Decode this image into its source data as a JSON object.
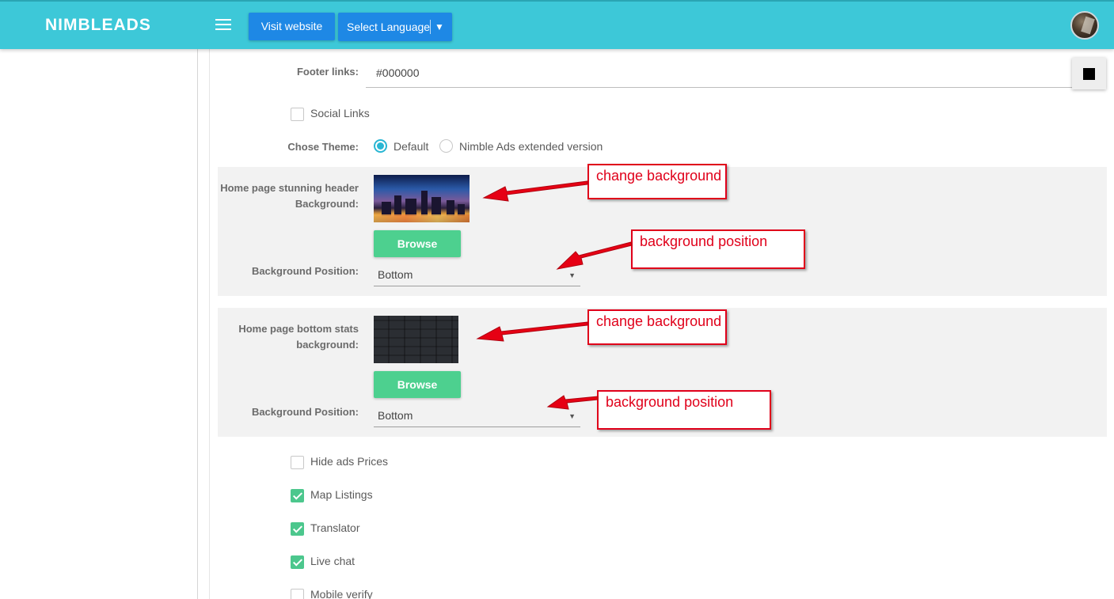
{
  "header": {
    "brand": "NIMBLEADS",
    "visit_label": "Visit website",
    "lang_label": "Select Language",
    "lang_caret": "▼"
  },
  "form": {
    "footer_links_label": "Footer links:",
    "footer_links_value": "#000000",
    "social_links_label": "Social Links",
    "theme_label": "Chose Theme:",
    "theme_option_default": "Default",
    "theme_option_extended": "Nimble Ads extended version",
    "home_header_bg_label": "Home page stunning header Background:",
    "home_bottom_bg_label": "Home page bottom stats background:",
    "browse_label": "Browse",
    "bg_position_label": "Background Position:",
    "bg_position_value_1": "Bottom",
    "bg_position_value_2": "Bottom",
    "hide_ads_prices_label": "Hide ads Prices",
    "map_listings_label": "Map Listings",
    "translator_label": "Translator",
    "live_chat_label": "Live chat",
    "mobile_verify_label": "Mobile verify"
  },
  "annotations": {
    "change_bg_1": "change background",
    "bg_pos_1": "background position",
    "change_bg_2": "change background",
    "bg_pos_2": "background position"
  },
  "colors": {
    "topbar": "#3dc8d8",
    "primary_button": "#1e88e5",
    "browse_button": "#4dd08f",
    "checkbox_on": "#4cc78d",
    "annotation_red": "#e0001a"
  }
}
